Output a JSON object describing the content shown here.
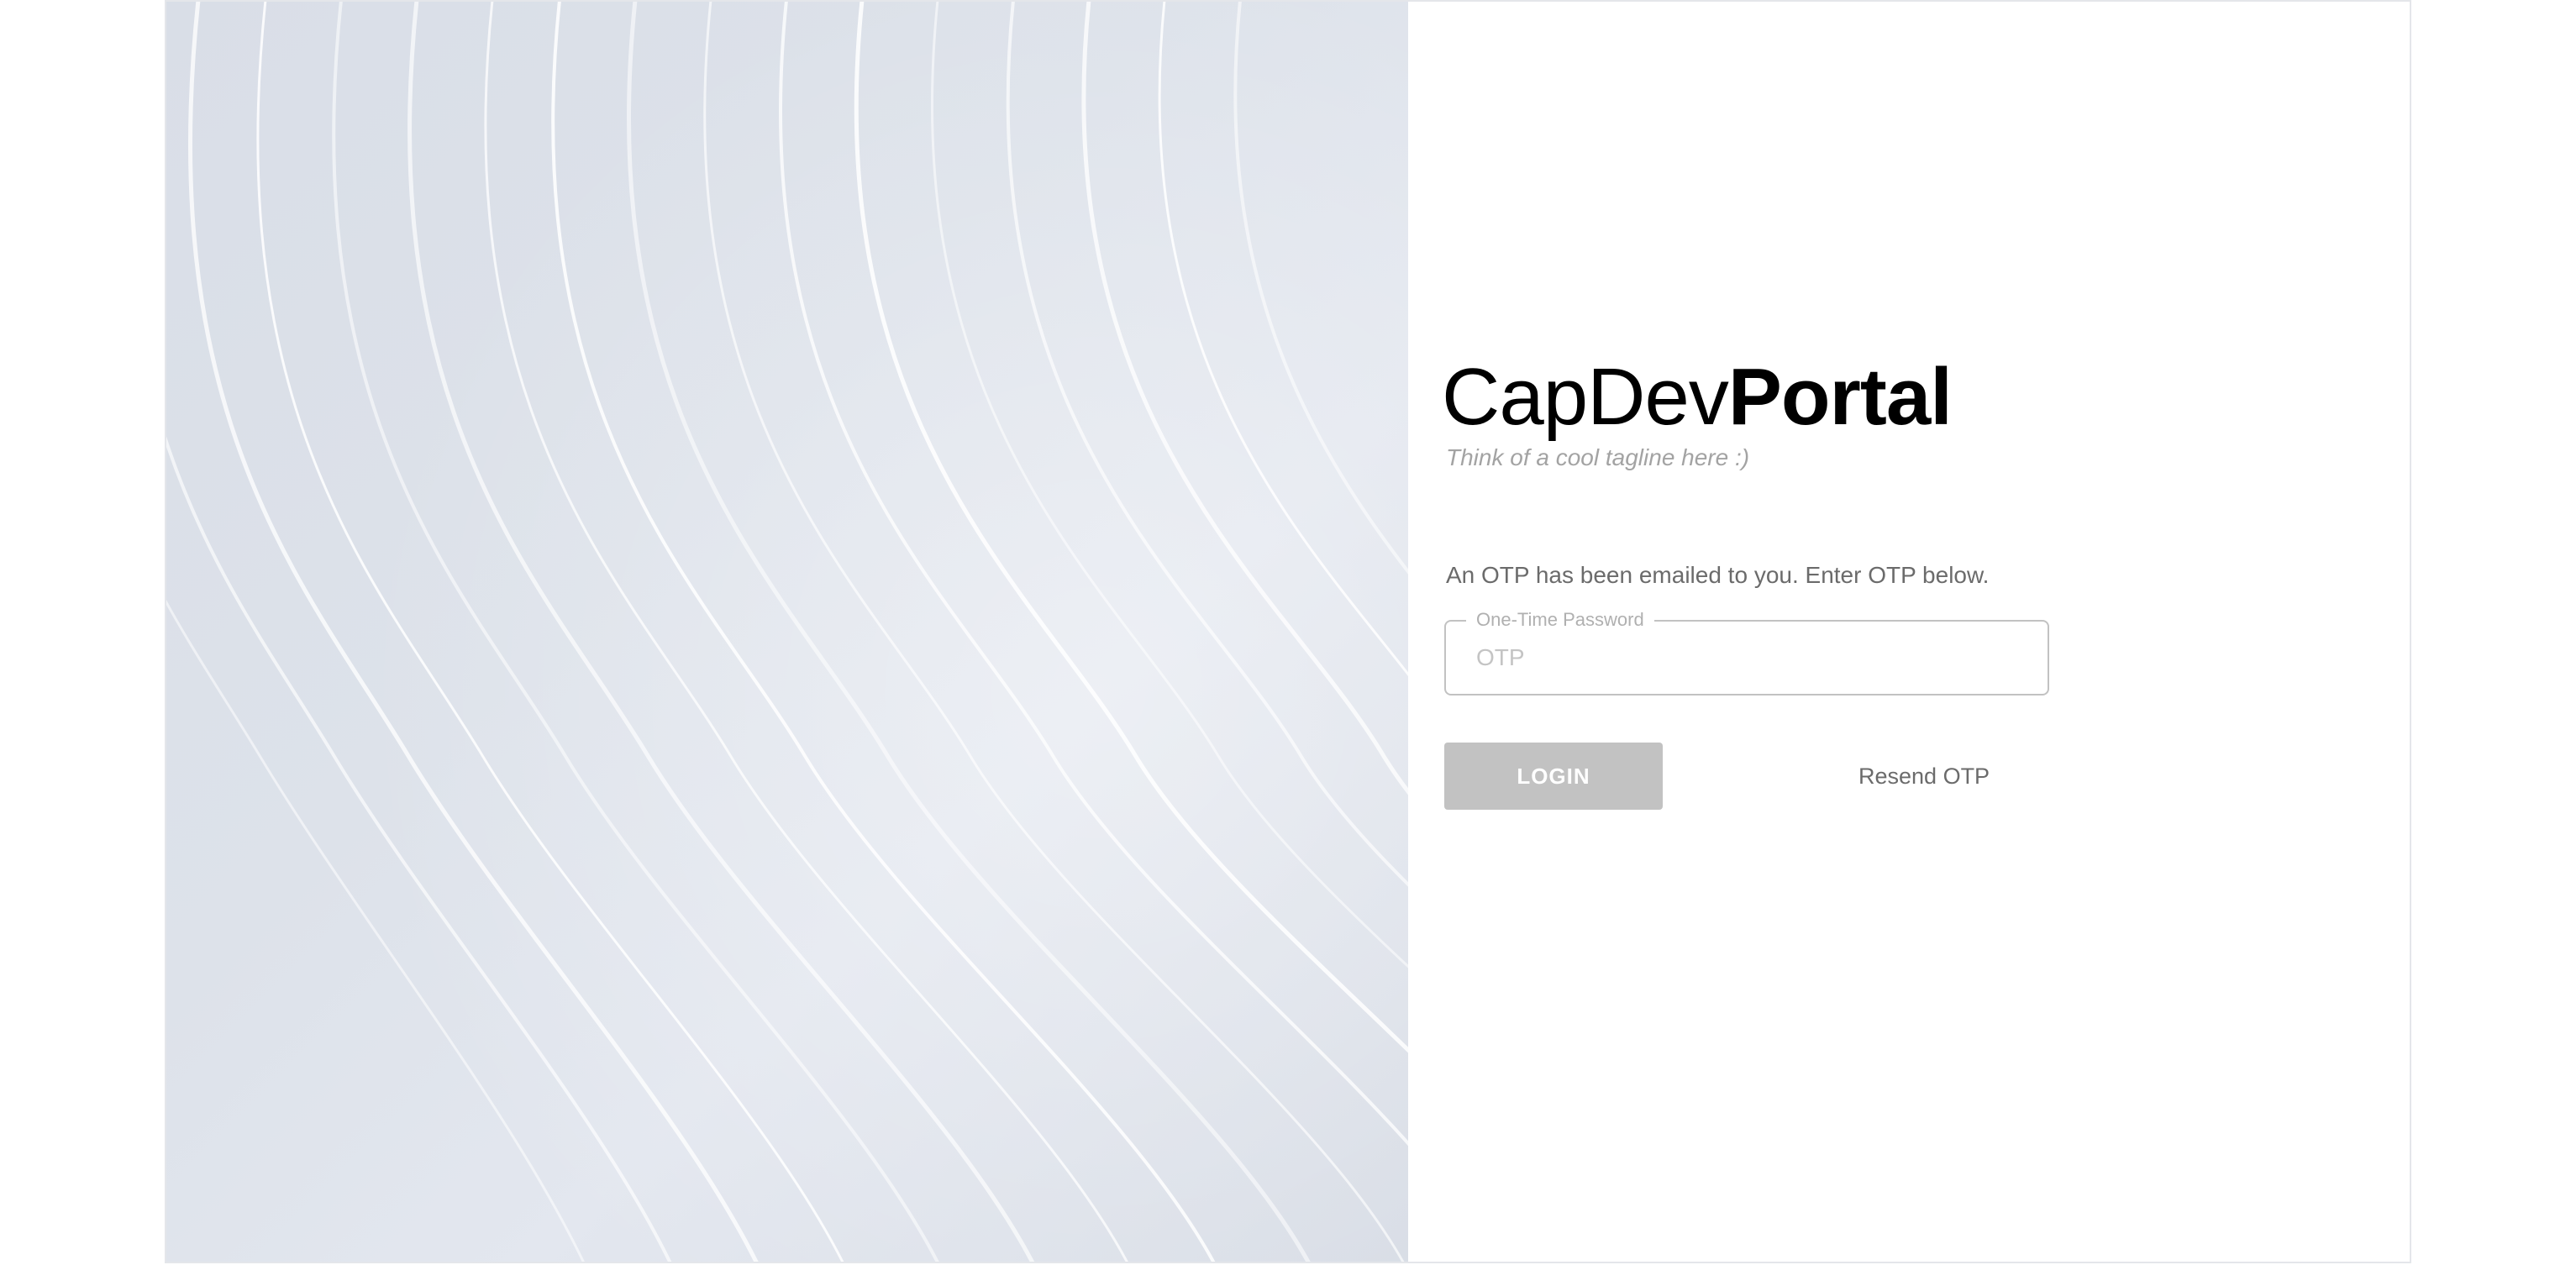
{
  "brand": {
    "name_regular": "CapDev",
    "name_bold": "Portal",
    "tagline": "Think of a cool tagline here :)"
  },
  "otp": {
    "instruction": "An OTP has been emailed to you. Enter OTP below.",
    "field_label": "One-Time Password",
    "placeholder": "OTP",
    "value": ""
  },
  "actions": {
    "login_label": "LOGIN",
    "resend_label": "Resend OTP"
  },
  "colors": {
    "button_disabled": "#c2c2c2",
    "field_border": "#c2c2c2",
    "hero_background": "#dde2ea",
    "muted_text": "#6b6b6b"
  }
}
